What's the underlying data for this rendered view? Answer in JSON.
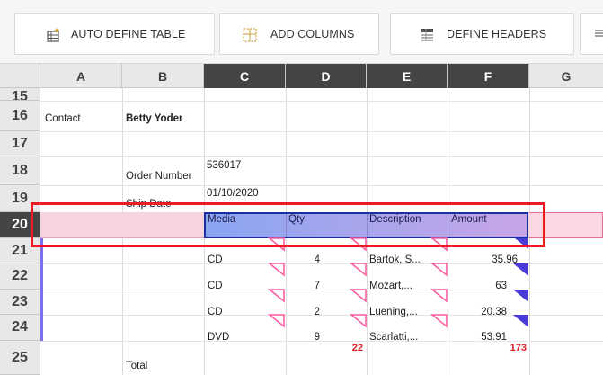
{
  "toolbar": {
    "buttons": [
      {
        "label": "AUTO DEFINE TABLE",
        "icon": "table-wand-icon"
      },
      {
        "label": "ADD COLUMNS",
        "icon": "add-columns-icon"
      },
      {
        "label": "DEFINE HEADERS",
        "icon": "define-headers-icon"
      },
      {
        "label": "",
        "icon": "overflow-icon"
      }
    ]
  },
  "columns": [
    "A",
    "B",
    "C",
    "D",
    "E",
    "F",
    "G"
  ],
  "selected_columns": [
    "C",
    "D",
    "E",
    "F"
  ],
  "rows": [
    "15",
    "16",
    "17",
    "18",
    "19",
    "20",
    "21",
    "22",
    "23",
    "24",
    "25"
  ],
  "selected_row": "20",
  "cells": {
    "a16": "Contact",
    "b16": "Betty Yoder",
    "b18": "Order Number",
    "c18": "536017",
    "b19": "Ship Date",
    "c19": "01/10/2020",
    "b25": "Total"
  },
  "table_headers": [
    "Media",
    "Qty",
    "Description",
    "Amount"
  ],
  "table_rows": [
    {
      "media": "CD",
      "qty": "4",
      "description": "Bartok, S...",
      "amount": "35.96"
    },
    {
      "media": "CD",
      "qty": "7",
      "description": "Mozart,...",
      "amount": "63"
    },
    {
      "media": "CD",
      "qty": "2",
      "description": "Luening,...",
      "amount": "20.38"
    },
    {
      "media": "DVD",
      "qty": "9",
      "description": "Scarlatti,...",
      "amount": "53.91"
    }
  ],
  "totals": {
    "qty": "22",
    "amount": "173"
  },
  "colors": {
    "highlight_border": "#ea1b24",
    "header_gradient_start": "#8aa5f2",
    "header_gradient_end": "#c7a5e6",
    "row_pink": "#f7d3dd",
    "marker_pink": "#ff5fa2",
    "marker_blue": "#4a3ad8"
  }
}
